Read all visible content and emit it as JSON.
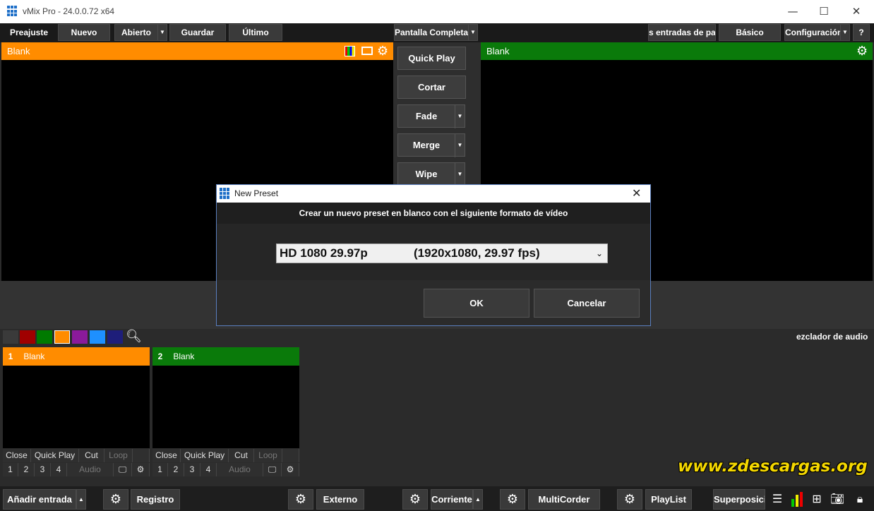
{
  "window": {
    "title": "vMix Pro - 24.0.0.72 x64",
    "minimize": "—",
    "maximize": "☐",
    "close": "✕"
  },
  "toolbar": {
    "preset_label": "Preajuste",
    "new": "Nuevo",
    "open": "Abierto",
    "save": "Guardar",
    "last": "Último",
    "fullscreen": "Pantalla Completa",
    "pause_inputs": "s entradas de pau",
    "basic": "Básico",
    "settings": "Configuración",
    "help": "?"
  },
  "preview": {
    "title": "Blank",
    "color": "#ff8c00"
  },
  "output": {
    "title": "Blank",
    "color": "#0a7a0a"
  },
  "transitions": {
    "quick_play": "Quick Play",
    "cut": "Cortar",
    "fade": "Fade",
    "merge": "Merge",
    "wipe": "Wipe"
  },
  "dialog": {
    "title": "New Preset",
    "message": "Crear un nuevo preset en blanco con el siguiente formato de vídeo",
    "format_name": "HD 1080 29.97p",
    "format_detail": "(1920x1080, 29.97 fps)",
    "ok": "OK",
    "cancel": "Cancelar"
  },
  "color_swatches": [
    "#3a3a3a",
    "#a00000",
    "#007a00",
    "#ff8c00",
    "#8b1a9b",
    "#1e90ff",
    "#1e1e7a"
  ],
  "audio_mixer_label": "ezclador de audio",
  "inputs": [
    {
      "number": "1",
      "title": "Blank",
      "color": "#ff8c00",
      "row1": [
        "Close",
        "Quick Play",
        "Cut",
        "Loop"
      ],
      "row2": [
        "1",
        "2",
        "3",
        "4",
        "Audio"
      ]
    },
    {
      "number": "2",
      "title": "Blank",
      "color": "#0a7a0a",
      "row1": [
        "Close",
        "Quick Play",
        "Cut",
        "Loop"
      ],
      "row2": [
        "1",
        "2",
        "3",
        "4",
        "Audio"
      ]
    }
  ],
  "bottombar": {
    "add_input": "Añadir entrada",
    "record": "Registro",
    "external": "Externo",
    "stream": "Corriente",
    "multicorder": "MultiCorder",
    "playlist": "PlayList",
    "overlay": "Superposición"
  },
  "watermark": "www.zdescargas.org"
}
